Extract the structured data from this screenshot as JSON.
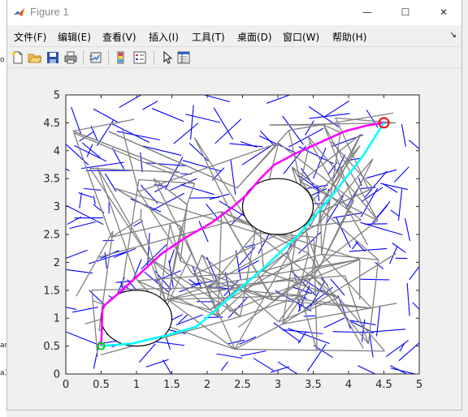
{
  "window": {
    "title": "Figure 1",
    "controls": {
      "minimize": "—",
      "maximize": "☐",
      "close": "✕"
    }
  },
  "menu": {
    "items": [
      "文件(F)",
      "编辑(E)",
      "查看(V)",
      "插入(I)",
      "工具(T)",
      "桌面(D)",
      "窗口(W)",
      "帮助(H)"
    ],
    "overflow_glyph": "↘"
  },
  "toolbar": {
    "buttons": [
      "new-figure-icon",
      "open-file-icon",
      "save-icon",
      "print-icon",
      "link-plot-icon",
      "colorbar-icon",
      "legend-icon",
      "pointer-icon",
      "property-editor-icon"
    ]
  },
  "background_fragments": [
    "o",
    "ar",
    "a1"
  ],
  "colors": {
    "tree": "#0000ff",
    "graph": "#808080",
    "path_magenta": "#ff00ff",
    "path_cyan": "#00ffff",
    "obstacle": "#000000",
    "start": "#00cc00",
    "goal": "#ff0000"
  },
  "chart_data": {
    "type": "line",
    "xlim": [
      0,
      5
    ],
    "ylim": [
      0,
      5
    ],
    "xticks": [
      "0",
      "0.5",
      "1",
      "1.5",
      "2",
      "2.5",
      "3",
      "3.5",
      "4",
      "4.5",
      "5"
    ],
    "yticks": [
      "0",
      "0.5",
      "1",
      "1.5",
      "2",
      "2.5",
      "3",
      "3.5",
      "4",
      "4.5",
      "5"
    ],
    "grid": false,
    "obstacles": [
      {
        "cx": 1.0,
        "cy": 1.0,
        "r": 0.5
      },
      {
        "cx": 3.0,
        "cy": 3.0,
        "r": 0.5
      }
    ],
    "start": {
      "x": 0.5,
      "y": 0.5
    },
    "goal": {
      "x": 4.5,
      "y": 4.5
    },
    "series": [
      {
        "color": "#ff00ff",
        "x": [
          0.5,
          0.52,
          0.75,
          1.05,
          1.35,
          1.7,
          2.05,
          2.35,
          2.55,
          2.75,
          2.95,
          3.25,
          3.6,
          3.95,
          4.25,
          4.5
        ],
        "y": [
          0.5,
          1.2,
          1.45,
          1.8,
          2.15,
          2.45,
          2.7,
          2.98,
          3.2,
          3.5,
          3.75,
          3.95,
          4.15,
          4.35,
          4.45,
          4.5
        ]
      },
      {
        "color": "#00ffff",
        "x": [
          0.5,
          0.95,
          1.45,
          1.85,
          2.3,
          2.8,
          3.3,
          3.8,
          4.2,
          4.5
        ],
        "y": [
          0.5,
          0.55,
          0.7,
          0.85,
          1.35,
          1.9,
          2.5,
          3.25,
          3.9,
          4.5
        ]
      }
    ]
  }
}
